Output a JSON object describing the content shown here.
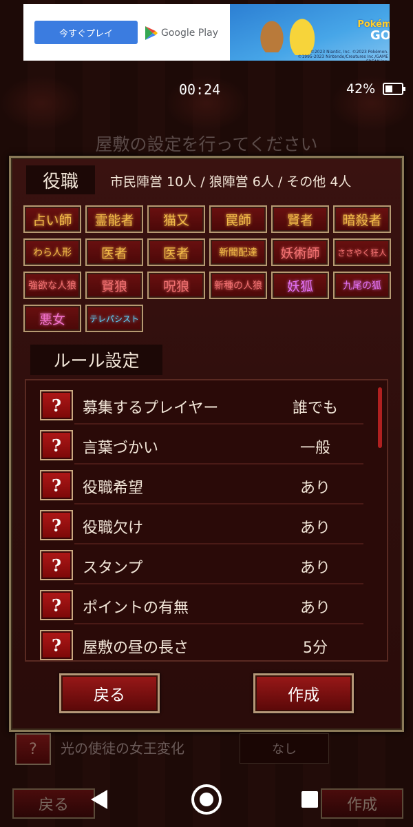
{
  "ad": {
    "cta_label": "今すぐプレイ",
    "store_label": "Google Play",
    "logo_top": "Pokémon",
    "logo_bottom": "GO",
    "copyright_line1": "©2023 Niantic, Inc. ©2023 Pokémon.",
    "copyright_line2": "©1995-2023 Nintendo/Creatures Inc./GAME FREAK inc."
  },
  "status": {
    "time": "00:24",
    "battery": "42%",
    "battery_level": 0.42
  },
  "header": {
    "title": "屋敷の設定を行ってください"
  },
  "roles": {
    "label": "役職",
    "summary": "市民陣営 10人 / 狼陣営 6人 / その他 4人",
    "items": [
      {
        "label": "占い師",
        "color": "#f0b848"
      },
      {
        "label": "霊能者",
        "color": "#f0b848"
      },
      {
        "label": "猫又",
        "color": "#f0b848"
      },
      {
        "label": "罠師",
        "color": "#f0b848"
      },
      {
        "label": "賢者",
        "color": "#f0b848"
      },
      {
        "label": "暗殺者",
        "color": "#f0b848"
      },
      {
        "label": "わら人形",
        "color": "#f0b848"
      },
      {
        "label": "医者",
        "color": "#f0b848"
      },
      {
        "label": "医者",
        "color": "#f0b848"
      },
      {
        "label": "新聞配達",
        "color": "#f0b848"
      },
      {
        "label": "妖術師",
        "color": "#f07070"
      },
      {
        "label": "ささやく狂人",
        "color": "#f07070"
      },
      {
        "label": "強欲な人狼",
        "color": "#f07070"
      },
      {
        "label": "賢狼",
        "color": "#f07070"
      },
      {
        "label": "呪狼",
        "color": "#f07070"
      },
      {
        "label": "新種の人狼",
        "color": "#f07070"
      },
      {
        "label": "妖狐",
        "color": "#e070f0"
      },
      {
        "label": "九尾の狐",
        "color": "#e070f0"
      },
      {
        "label": "悪女",
        "color": "#f070c8"
      },
      {
        "label": "テレパシスト",
        "color": "#60d0f8"
      }
    ]
  },
  "rules": {
    "label": "ルール設定",
    "items": [
      {
        "name": "募集するプレイヤー",
        "value": "誰でも"
      },
      {
        "name": "言葉づかい",
        "value": "一般"
      },
      {
        "name": "役職希望",
        "value": "あり"
      },
      {
        "name": "役職欠け",
        "value": "あり"
      },
      {
        "name": "スタンプ",
        "value": "あり"
      },
      {
        "name": "ポイントの有無",
        "value": "あり"
      },
      {
        "name": "屋敷の昼の長さ",
        "value": "5分"
      }
    ],
    "help_glyph": "?"
  },
  "actions": {
    "back": "戻る",
    "create": "作成"
  },
  "background_screen": {
    "rule_name": "光の使徒の女王変化",
    "rule_value": "なし",
    "back": "戻る",
    "create": "作成"
  }
}
